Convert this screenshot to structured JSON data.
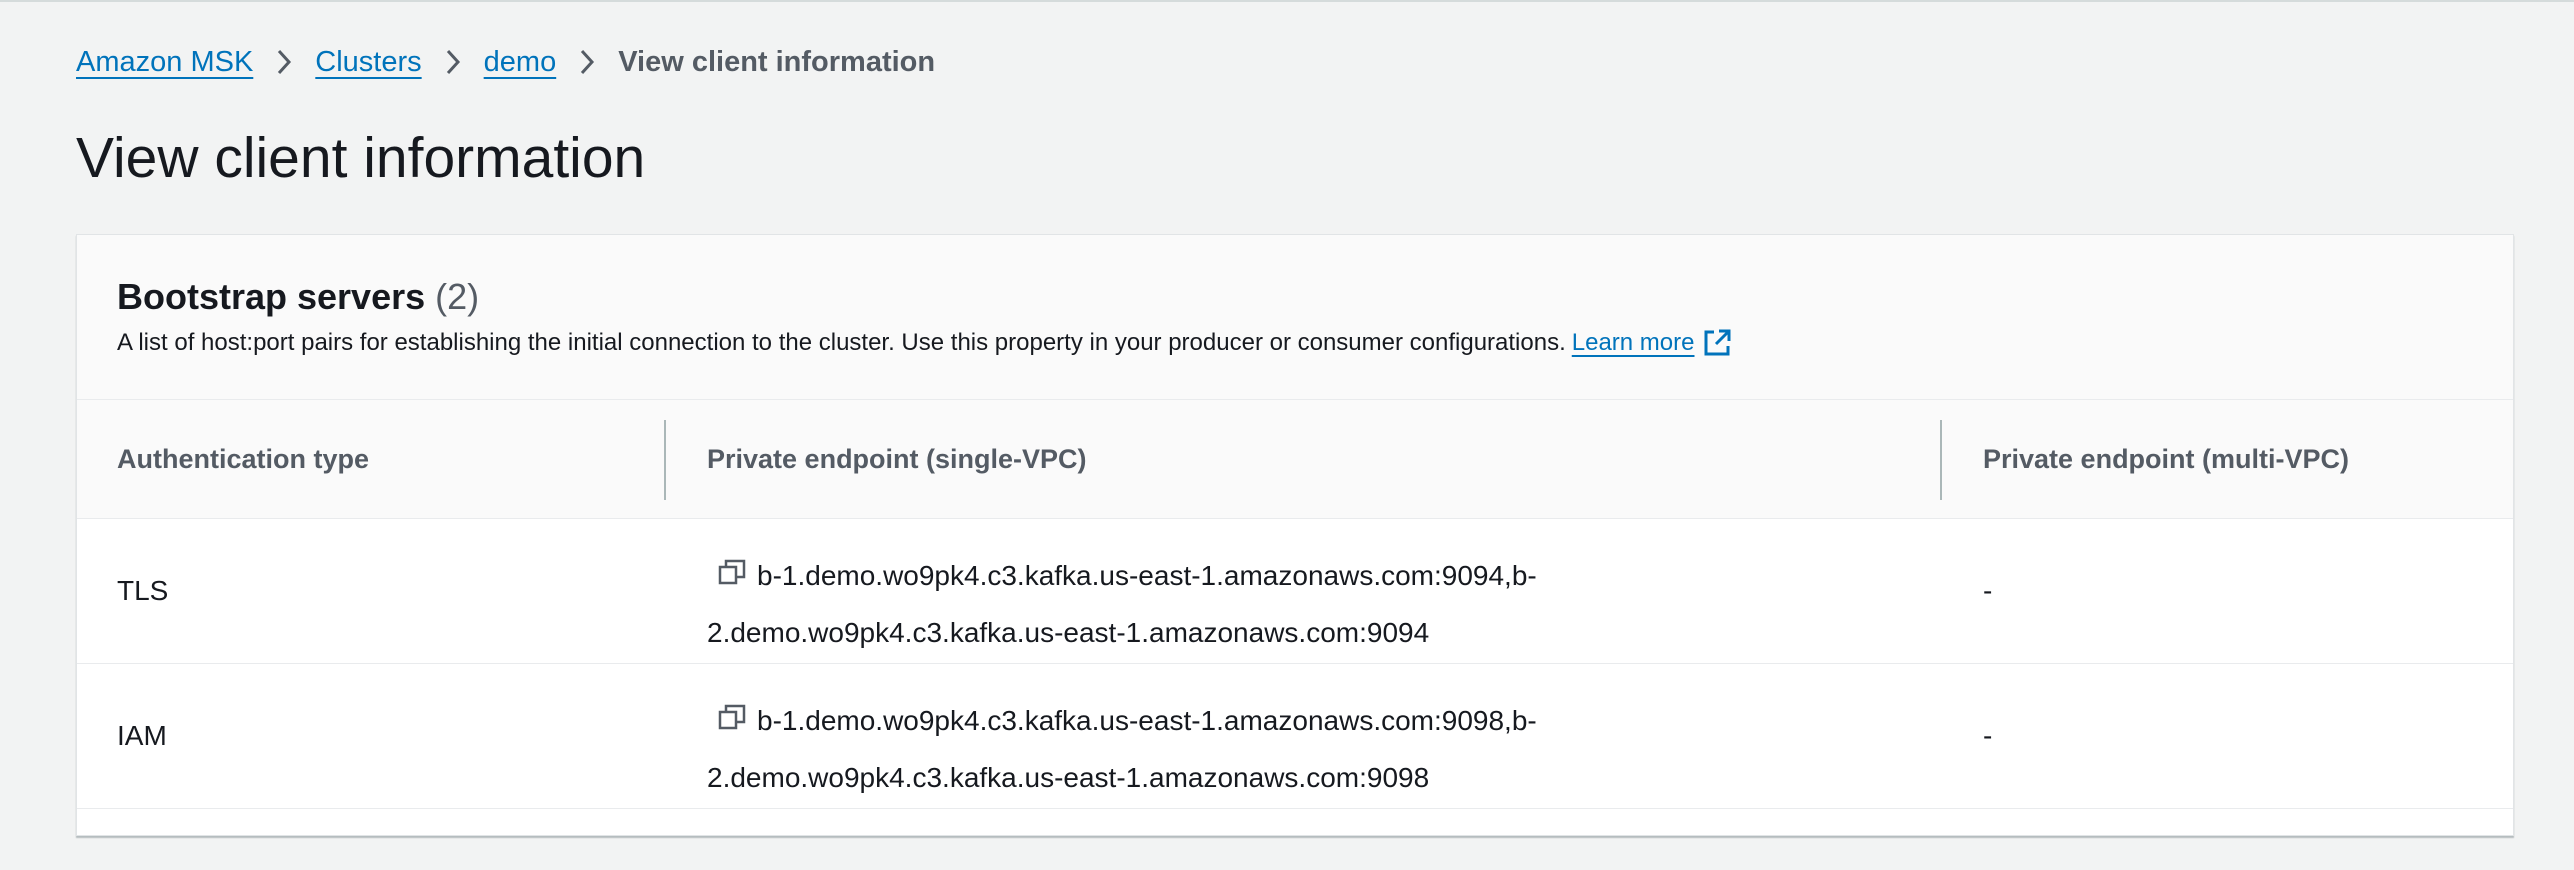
{
  "breadcrumb": {
    "items": [
      "Amazon MSK",
      "Clusters",
      "demo"
    ],
    "current": "View client information"
  },
  "page": {
    "title": "View client information"
  },
  "card": {
    "title": "Bootstrap servers",
    "count": "(2)",
    "description": "A list of host:port pairs for establishing the initial connection to the cluster. Use this property in your producer or consumer configurations.",
    "learn_more": "Learn more",
    "icons": {
      "external": "external-link-icon",
      "copy": "copy-icon",
      "separator": "chevron-right-icon"
    }
  },
  "table": {
    "columns": [
      "Authentication type",
      "Private endpoint (single-VPC)",
      "Private endpoint (multi-VPC)"
    ],
    "rows": [
      {
        "auth": "TLS",
        "single_vpc_line1": "b-1.demo.wo9pk4.c3.kafka.us-east-1.amazonaws.com:9094,b-",
        "single_vpc_line2": "2.demo.wo9pk4.c3.kafka.us-east-1.amazonaws.com:9094",
        "multi_vpc": "-"
      },
      {
        "auth": "IAM",
        "single_vpc_line1": "b-1.demo.wo9pk4.c3.kafka.us-east-1.amazonaws.com:9098,b-",
        "single_vpc_line2": "2.demo.wo9pk4.c3.kafka.us-east-1.amazonaws.com:9098",
        "multi_vpc": "-"
      }
    ]
  },
  "colors": {
    "link": "#0073bb",
    "background": "#f2f3f3",
    "text": "#16191f",
    "muted": "#545b64"
  }
}
